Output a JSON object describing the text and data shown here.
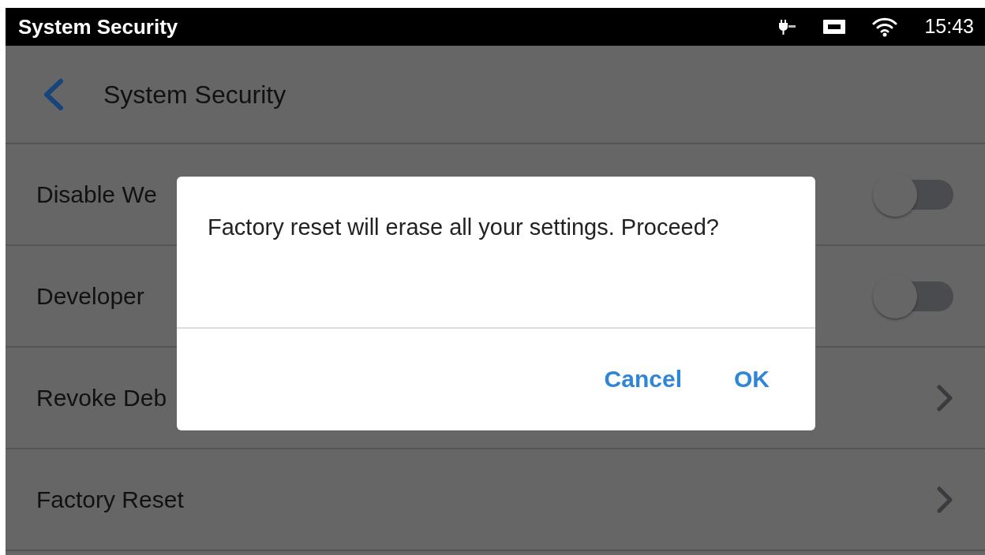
{
  "status_bar": {
    "title": "System Security",
    "time": "15:43"
  },
  "header": {
    "title": "System Security"
  },
  "rows": [
    {
      "label": "Disable We",
      "kind": "switch",
      "on": false
    },
    {
      "label": "Developer",
      "kind": "switch",
      "on": false
    },
    {
      "label": "Revoke Deb",
      "kind": "link"
    },
    {
      "label": "Factory Reset",
      "kind": "link"
    }
  ],
  "dialog": {
    "message": "Factory reset will erase all your settings. Proceed?",
    "buttons": [
      "Cancel",
      "OK"
    ]
  }
}
